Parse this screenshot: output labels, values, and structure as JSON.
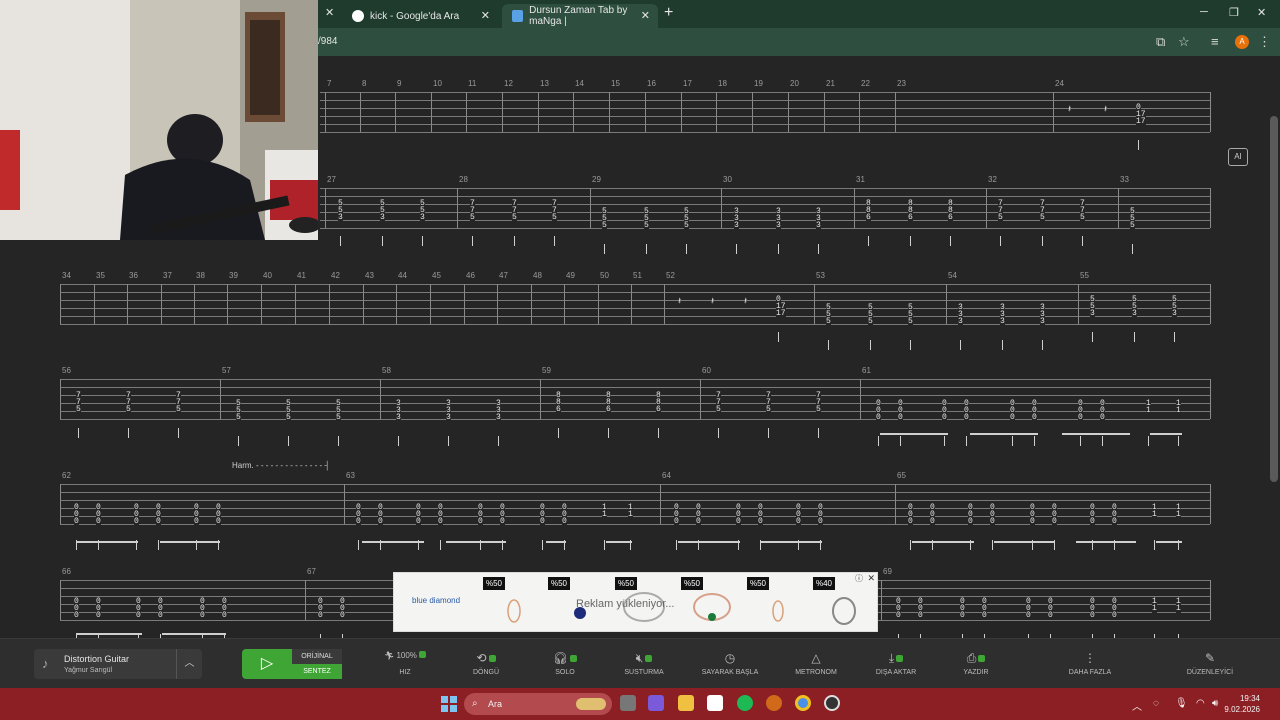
{
  "browser": {
    "tabs": [
      {
        "title": "kick - Google'da Ara"
      },
      {
        "title": "Dursun Zaman Tab by maNga | "
      }
    ],
    "url": "/984",
    "profile_initial": "A"
  },
  "score": {
    "row1_measures": [
      "7",
      "8",
      "9",
      "10",
      "11",
      "12",
      "13",
      "14",
      "15",
      "16",
      "17",
      "18",
      "19",
      "20",
      "21",
      "22",
      "23",
      "24"
    ],
    "row2_measures": [
      "27",
      "28",
      "29",
      "30",
      "31",
      "32",
      "33"
    ],
    "row3_measures": [
      "34",
      "35",
      "36",
      "37",
      "38",
      "39",
      "40",
      "41",
      "42",
      "43",
      "44",
      "45",
      "46",
      "47",
      "48",
      "49",
      "50",
      "51",
      "52",
      "53",
      "54",
      "55"
    ],
    "row4_measures": [
      "56",
      "57",
      "58",
      "59",
      "60",
      "61"
    ],
    "row5_measures": [
      "62",
      "63",
      "64",
      "65"
    ],
    "row6_measures": [
      "66",
      "67",
      "69"
    ],
    "harm_label": "Harm.",
    "ai_label": "AI"
  },
  "ad": {
    "logo": "blue diamond",
    "badges": [
      "%50",
      "%50",
      "%50",
      "%50",
      "%50",
      "%40"
    ],
    "loading_text": "Reklam yükleniyor..."
  },
  "player": {
    "track_name": "Distortion Guitar",
    "track_artist": "Yağmur Sarıgül",
    "original_label": "ORİJİNAL",
    "sentez_label": "SENTEZ",
    "speed_value": "100%",
    "controls": [
      "HIZ",
      "DÖNGÜ",
      "SOLO",
      "SUSTURMA",
      "SAYARAK BAŞLA",
      "METRONOM",
      "DIŞA AKTAR",
      "YAZDIR",
      "DAHA FAZLA",
      "DÜZENLEYİCİ"
    ]
  },
  "taskbar": {
    "search_placeholder": "Ara",
    "time": "19:34",
    "date": "9.02.2026"
  },
  "colors": {
    "accent_green": "#3fa535",
    "taskbar_red": "#8c1f24",
    "browser_green": "#1e3b2e"
  }
}
